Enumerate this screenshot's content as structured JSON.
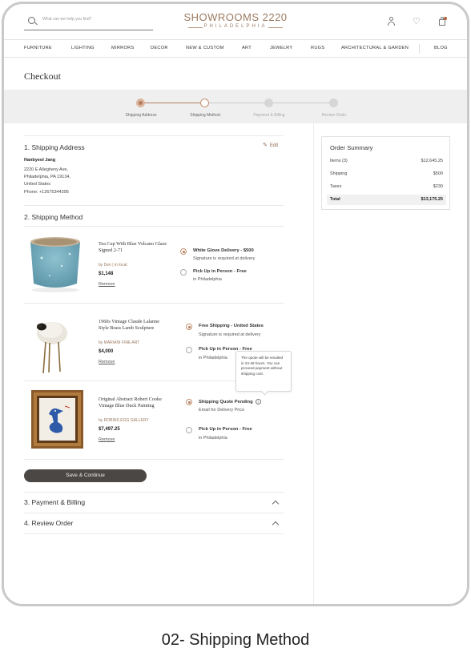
{
  "header": {
    "search_placeholder": "What can we help you find?",
    "logo_main": "SHOWROOMS 2220",
    "logo_sub": "PHILADELPHIA"
  },
  "nav": [
    "FURNITURE",
    "LIGHTING",
    "MIRRORS",
    "DECOR",
    "NEW & CUSTOM",
    "ART",
    "JEWELRY",
    "RUGS",
    "ARCHITECTURAL & GARDEN",
    "BLOG"
  ],
  "page_title": "Checkout",
  "steps": [
    {
      "label": "Shipping Address",
      "state": "done"
    },
    {
      "label": "Shipping Method",
      "state": "current"
    },
    {
      "label": "Payment & Billing",
      "state": "todo"
    },
    {
      "label": "Review Order",
      "state": "todo"
    }
  ],
  "shipping_address": {
    "title": "1. Shipping Address",
    "edit": "Edit",
    "name": "Hanbyeol Jang",
    "line1": "2220 E Allegheny Ave,",
    "line2": "Philadelphia, PA 19134,",
    "country": "United States",
    "phone": "Phone: +12675344395"
  },
  "shipping_method": {
    "title": "2. Shipping Method",
    "remove": "Remove",
    "items": [
      {
        "title": "Tea Cup With Blue Volcano Glaze Signed 2-71",
        "seller": "by Den  |  in local",
        "price": "$1,148",
        "options": [
          {
            "label": "White Glove Delivery - $500",
            "sub": "Signature is required at delivery",
            "selected": true
          },
          {
            "label": "Pick Up in Person - Free",
            "sub": "in Philadelphia",
            "selected": false
          }
        ]
      },
      {
        "title": "1960s Vintage Claude Lalanne Style Brass Lamb Sculpture",
        "seller": "by MARIANI FINE ART",
        "price": "$4,000",
        "options": [
          {
            "label": "Free Shipping - United States",
            "sub": "Signature is required at delivery",
            "selected": true
          },
          {
            "label": "Pick Up in Person - Free",
            "sub": "in Philadelphia",
            "selected": false
          }
        ]
      },
      {
        "title": "Original Abstract Robert Cooke Vintage Blue Duck Painting",
        "seller": "by ROBINS EGG GALLERY",
        "price": "$7,497.25",
        "options": [
          {
            "label": "Shipping Quote Pending",
            "sub": "Email for Delivery Price",
            "selected": true
          },
          {
            "label": "Pick Up in Person - Free",
            "sub": "in Philadelphia",
            "selected": false
          }
        ]
      }
    ],
    "tooltip": "The quote will be emailed in 24-48 hours. You can proceed payment without shipping cost.",
    "save_button": "Save & Continue"
  },
  "payment_title": "3. Payment & Billing",
  "review_title": "4. Review Order",
  "summary": {
    "title": "Order Summary",
    "rows": [
      {
        "k": "Items (3)",
        "v": "$12,645.25"
      },
      {
        "k": "Shipping",
        "v": "$500"
      },
      {
        "k": "Taxes",
        "v": "$230"
      },
      {
        "k": "Total",
        "v": "$13,175.25"
      }
    ]
  },
  "caption": "02- Shipping Method",
  "colors": {
    "accent": "#b07c5e",
    "brand": "#9c7a60",
    "button": "#4a4745"
  }
}
